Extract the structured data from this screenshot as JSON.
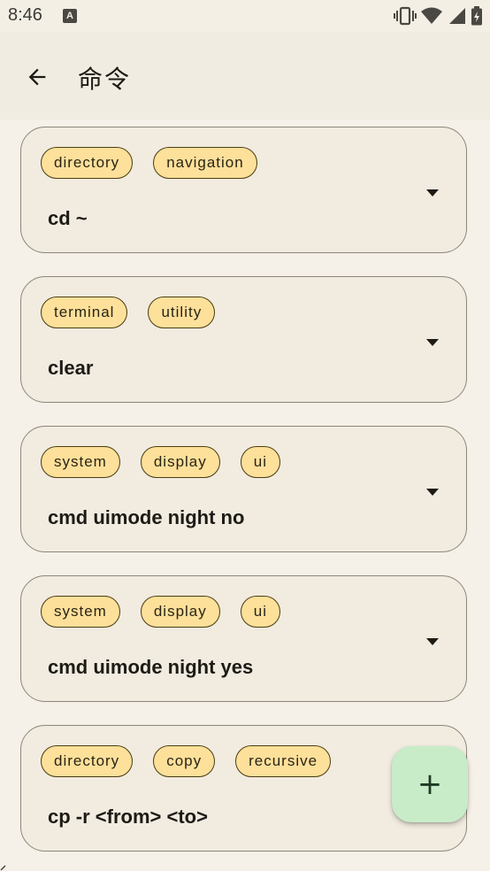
{
  "status_bar": {
    "time": "8:46",
    "notification_icon": "A",
    "icons": [
      "vibrate-icon",
      "wifi-icon",
      "cell-signal-icon",
      "battery-icon"
    ]
  },
  "app_bar": {
    "back_icon": "arrow-back-icon",
    "title": "命令"
  },
  "commands": [
    {
      "tags": [
        "directory",
        "navigation"
      ],
      "command": "cd ~"
    },
    {
      "tags": [
        "terminal",
        "utility"
      ],
      "command": "clear"
    },
    {
      "tags": [
        "system",
        "display",
        "ui"
      ],
      "command": "cmd uimode night no"
    },
    {
      "tags": [
        "system",
        "display",
        "ui"
      ],
      "command": "cmd uimode night yes"
    },
    {
      "tags": [
        "directory",
        "copy",
        "recursive"
      ],
      "command": "cp -r <from> <to>"
    }
  ],
  "fab": {
    "icon": "add-icon",
    "label": "+"
  },
  "colors": {
    "background": "#f5f0e8",
    "card_border": "#8c8779",
    "chip_fill": "#fde09a",
    "fab_fill": "#c8ecc8"
  }
}
